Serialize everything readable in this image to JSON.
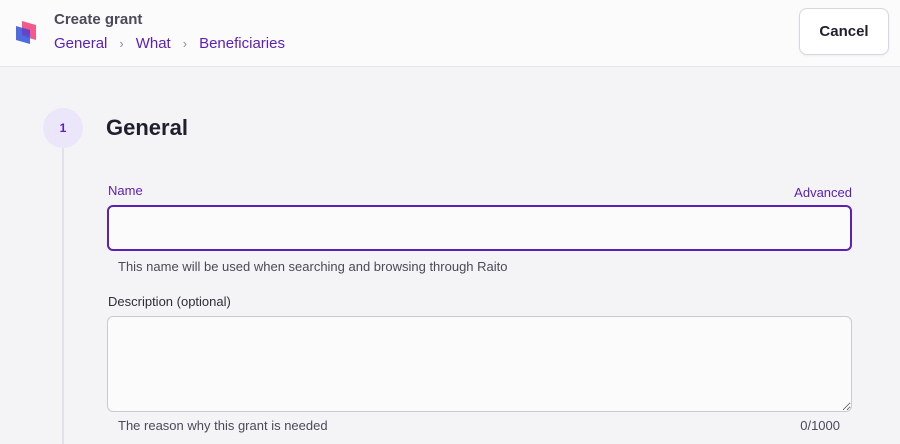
{
  "header": {
    "title": "Create grant",
    "breadcrumbs": [
      "General",
      "What",
      "Beneficiaries"
    ],
    "cancel_label": "Cancel"
  },
  "step": {
    "number": "1",
    "title": "General"
  },
  "form": {
    "name": {
      "label": "Name",
      "value": "",
      "helper": "This name will be used when searching and browsing through Raito",
      "advanced_label": "Advanced"
    },
    "description": {
      "label": "Description (optional)",
      "value": "",
      "helper": "The reason why this grant is needed",
      "counter": "0/1000"
    }
  },
  "colors": {
    "accent": "#5b21b6",
    "step_bg": "#ece6fb",
    "page_bg": "#f4f4f6"
  },
  "icons": {
    "logo": "raito-logo-icon",
    "breadcrumb_separator": "chevron-right-icon"
  }
}
